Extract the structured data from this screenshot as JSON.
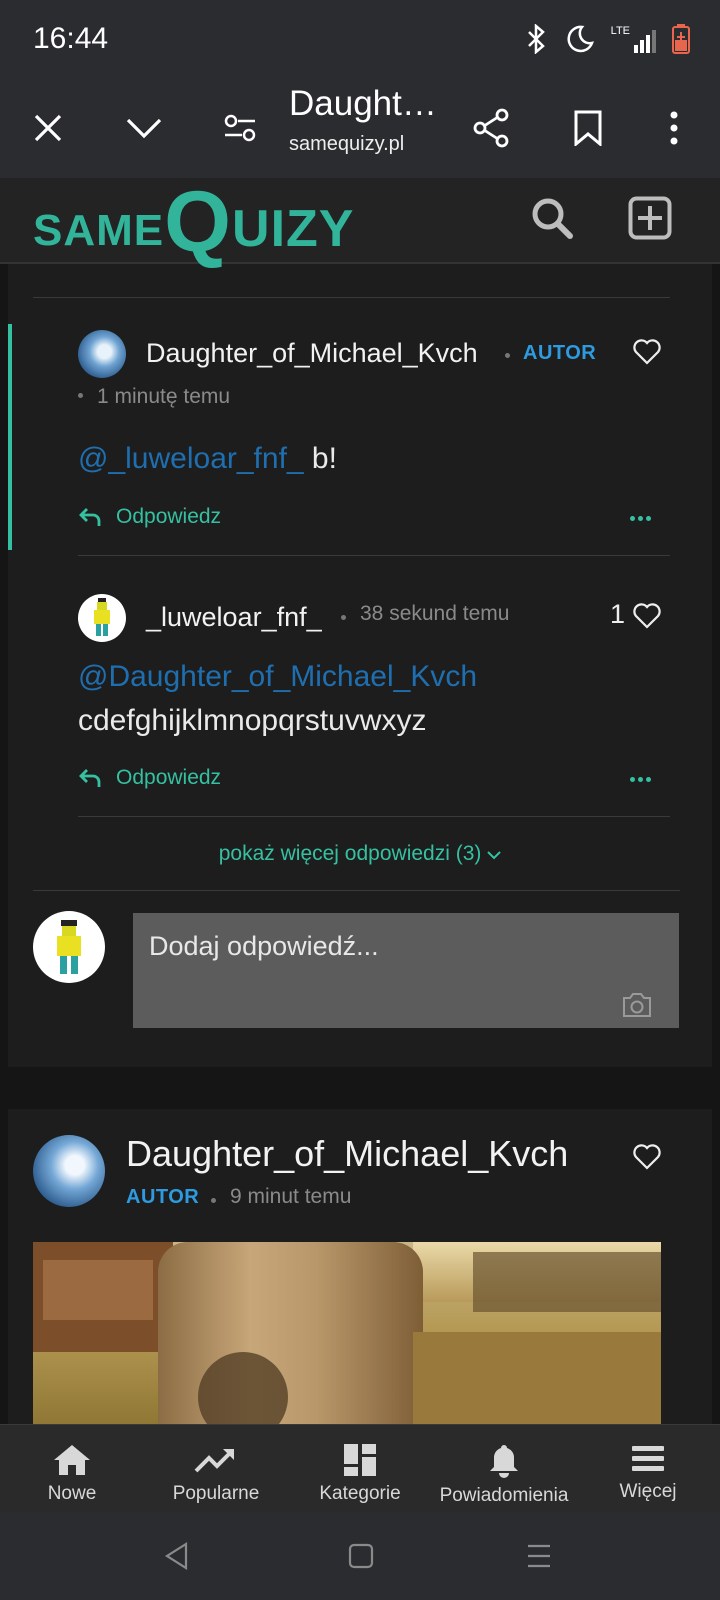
{
  "status_bar": {
    "time": "16:44",
    "network_label": "LTE"
  },
  "browser": {
    "title": "Daught…",
    "url": "samequizy.pl"
  },
  "site": {
    "logo_same": "SAME",
    "logo_q": "Q",
    "logo_uizy": "UIZY"
  },
  "comments": [
    {
      "author": "Daughter_of_Michael_Kvch",
      "badge": "AUTOR",
      "time": "1 minutę temu",
      "mention": "@_luweloar_fnf_",
      "text": " b!",
      "reply_label": "Odpowiedz"
    },
    {
      "author": "_luweloar_fnf_",
      "time": "38 sekund temu",
      "likes": "1",
      "mention": "@Daughter_of_Michael_Kvch",
      "text": "cdefghijklmnopqrstuvwxyz",
      "reply_label": "Odpowiedz"
    }
  ],
  "show_more_replies": "pokaż więcej odpowiedzi (3)",
  "reply_input": {
    "placeholder": "Dodaj odpowiedź..."
  },
  "post": {
    "author": "Daughter_of_Michael_Kvch",
    "badge": "AUTOR",
    "time": "9 minut temu"
  },
  "bottom_nav": [
    {
      "label": "Nowe",
      "icon": "home-icon"
    },
    {
      "label": "Popularne",
      "icon": "trending-icon"
    },
    {
      "label": "Kategorie",
      "icon": "categories-icon"
    },
    {
      "label": "Powiadomienia",
      "icon": "bell-icon"
    },
    {
      "label": "Więcej",
      "icon": "menu-icon"
    }
  ],
  "colors": {
    "accent": "#35c0a2",
    "author_badge": "#2e9be0",
    "mention": "#1f6fb0"
  }
}
